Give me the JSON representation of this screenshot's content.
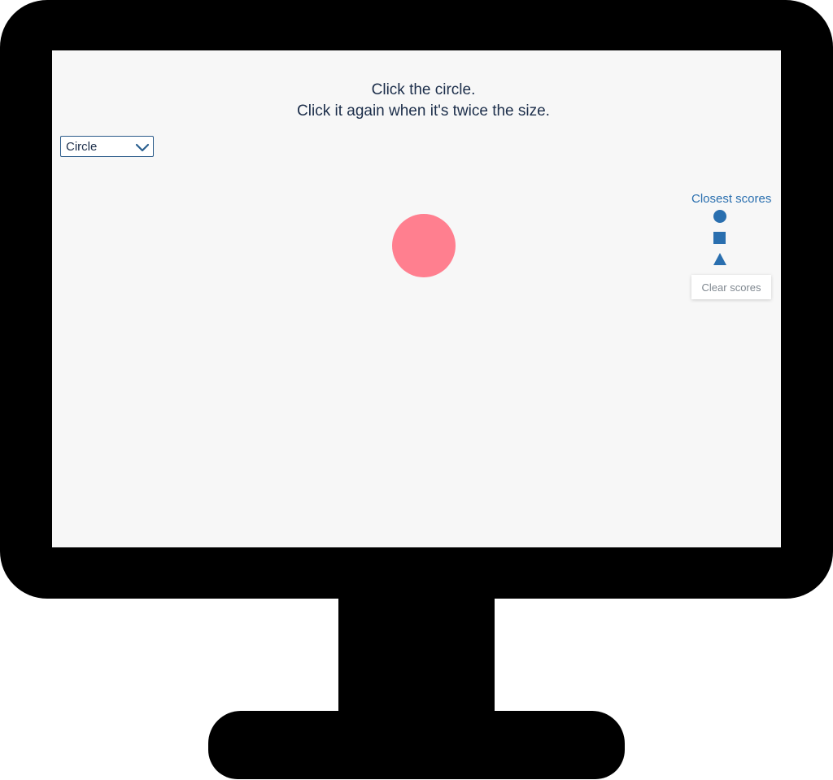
{
  "instructions": {
    "line1": "Click the circle.",
    "line2": "Click it again when it's twice the size."
  },
  "shape_select": {
    "selected": "Circle",
    "icon": "chevron-down-icon"
  },
  "target": {
    "shape": "circle",
    "color": "#ff7f8f"
  },
  "scores": {
    "title": "Closest scores",
    "rows": [
      {
        "icon": "circle-icon"
      },
      {
        "icon": "square-icon"
      },
      {
        "icon": "triangle-icon"
      }
    ],
    "clear_label": "Clear scores"
  },
  "colors": {
    "accent": "#2a6faf",
    "text": "#1c2e4a",
    "screen_bg": "#f7f7f7",
    "bezel": "#000000"
  }
}
